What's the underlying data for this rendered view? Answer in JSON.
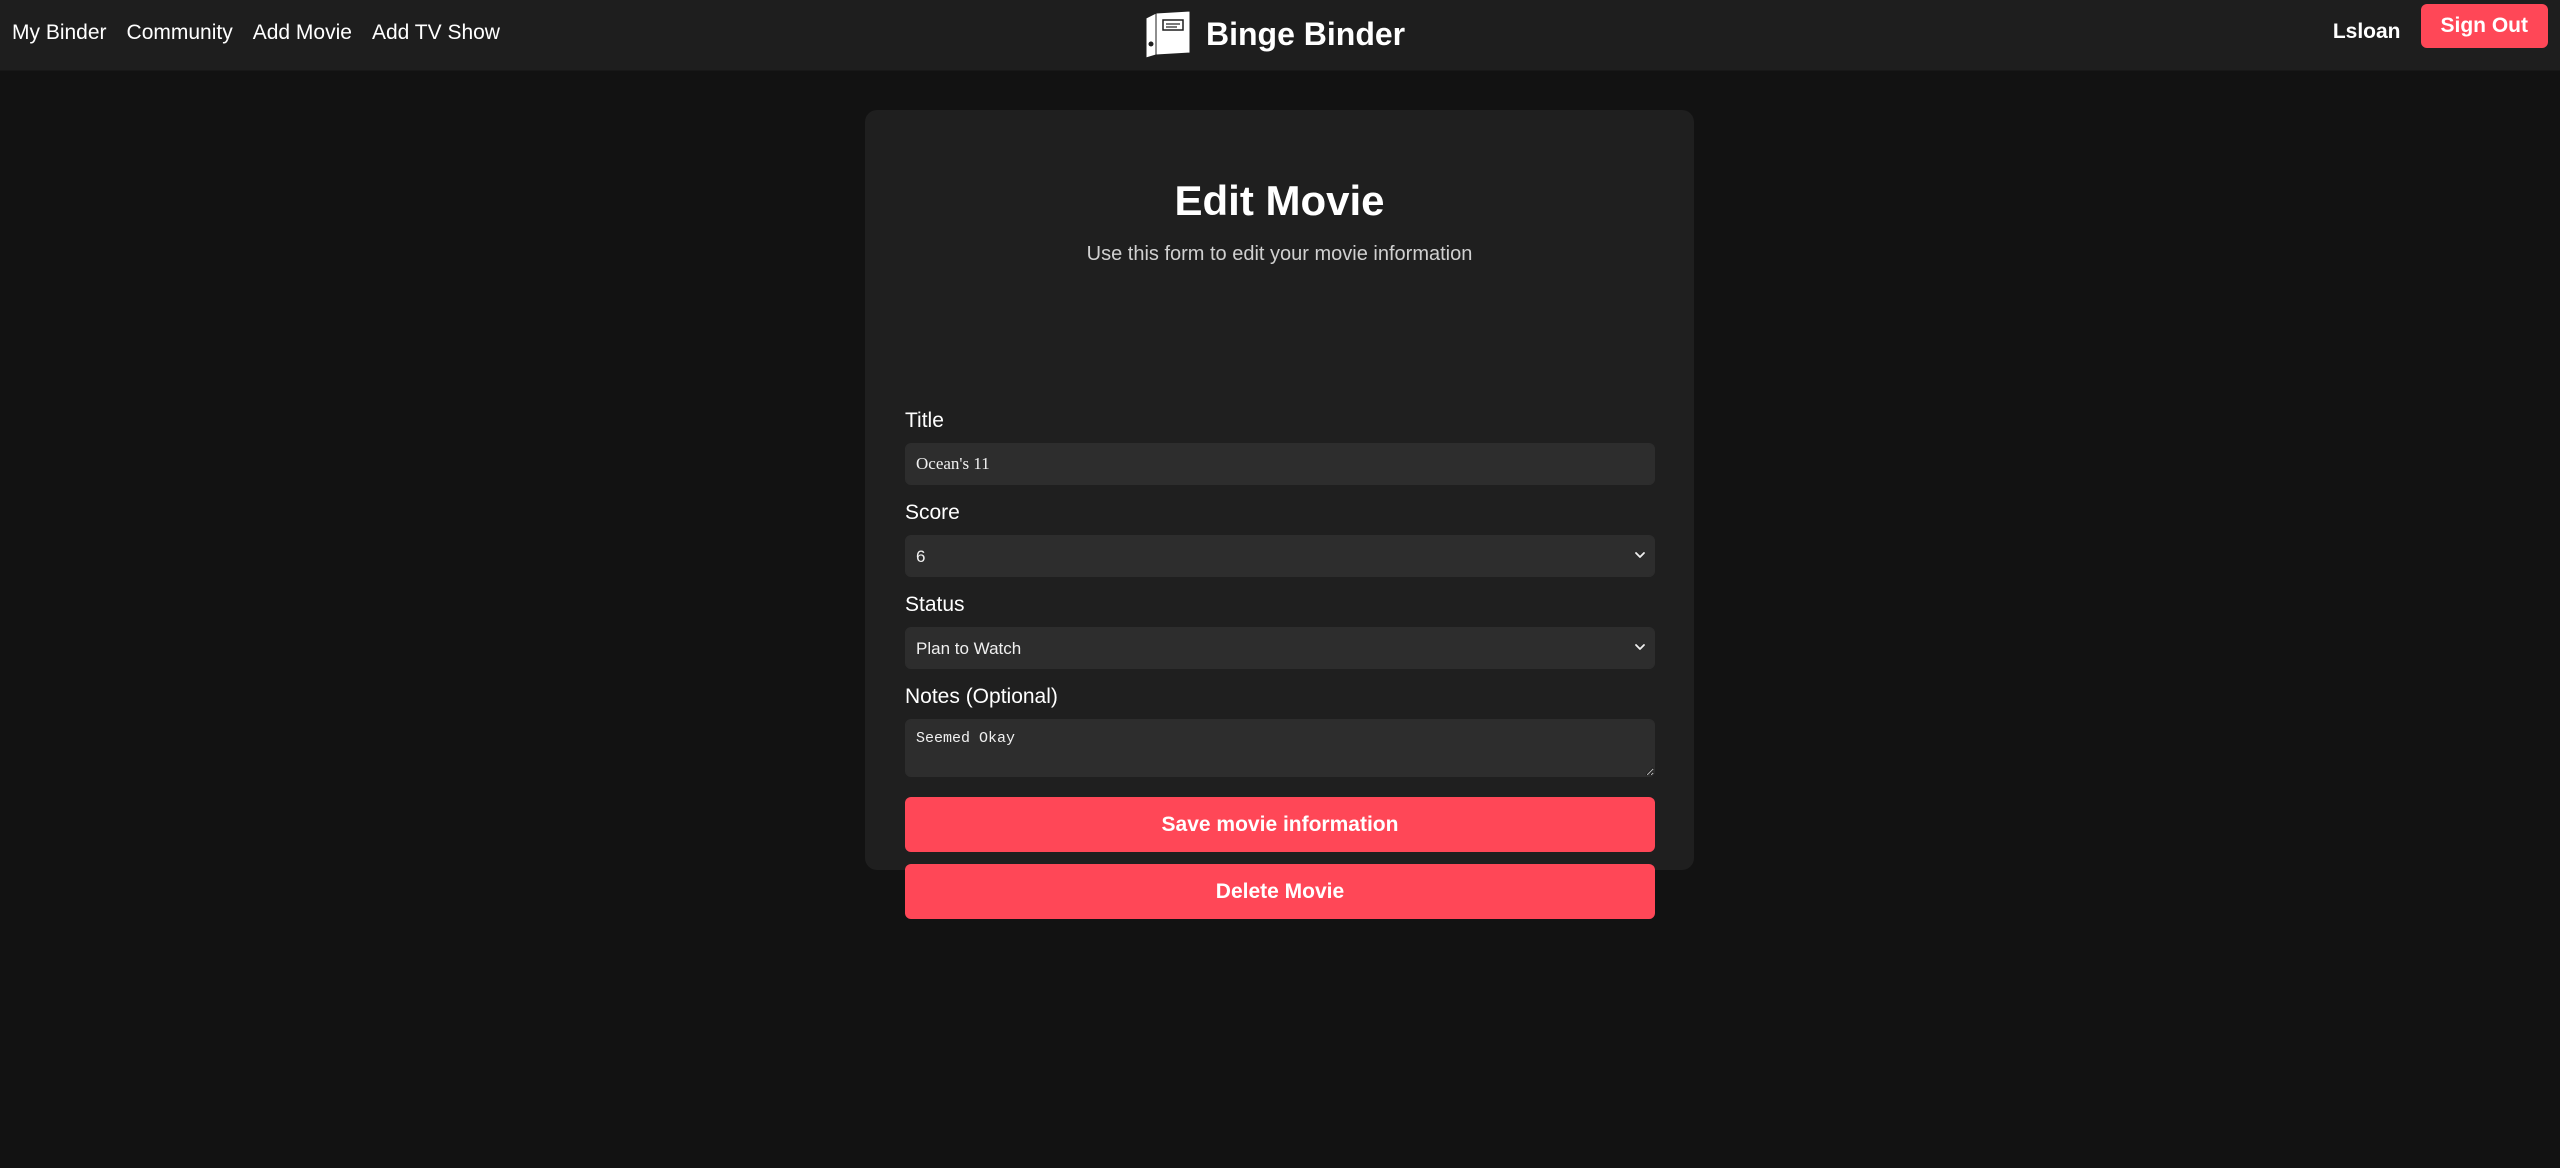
{
  "nav": {
    "links": [
      "My Binder",
      "Community",
      "Add Movie",
      "Add TV Show"
    ],
    "brand": "Binge Binder",
    "username": "Lsloan",
    "sign_out": "Sign Out"
  },
  "card": {
    "title": "Edit Movie",
    "subtitle": "Use this form to edit your movie information"
  },
  "form": {
    "title_label": "Title",
    "title_value": "Ocean's 11",
    "score_label": "Score",
    "score_value": "6",
    "status_label": "Status",
    "status_value": "Plan to Watch",
    "notes_label": "Notes (Optional)",
    "notes_value": "Seemed Okay",
    "save_label": "Save movie information",
    "delete_label": "Delete Movie"
  },
  "colors": {
    "accent": "#ff4757",
    "background": "#121212",
    "navbar": "#1e1e1e",
    "card": "#1f1f1f",
    "input": "#2d2d2d"
  },
  "icons": {
    "logo": "binder-icon",
    "select_arrow": "chevron-down-icon"
  }
}
